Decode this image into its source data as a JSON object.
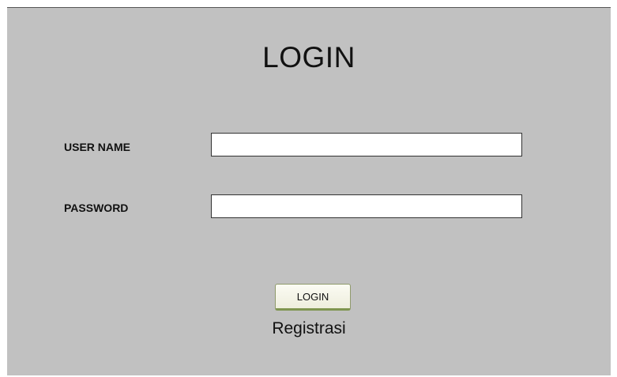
{
  "login_form": {
    "title": "LOGIN",
    "username": {
      "label": "USER NAME",
      "value": "",
      "placeholder": ""
    },
    "password": {
      "label": "PASSWORD",
      "value": "",
      "placeholder": ""
    },
    "submit_label": "LOGIN",
    "register_link_text": "Registrasi"
  },
  "colors": {
    "panel_background": "#c1c1c1",
    "button_accent": "#7f9550"
  }
}
